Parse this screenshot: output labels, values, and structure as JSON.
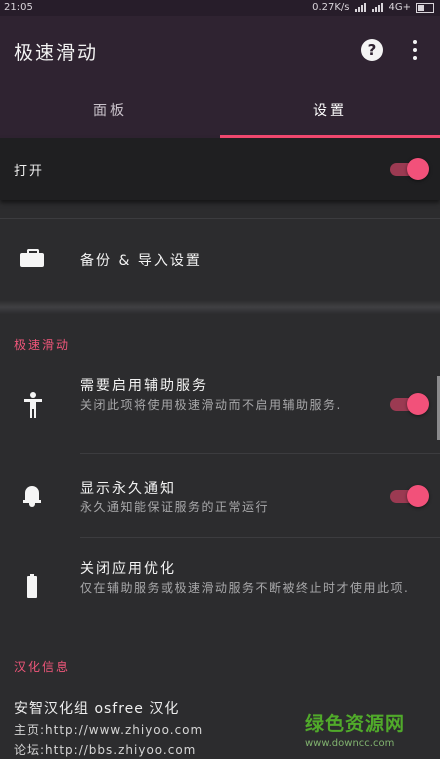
{
  "status_bar": {
    "time": "21:05",
    "speed": "0.27K/s",
    "network": "4G+"
  },
  "app_bar": {
    "title": "极速滑动",
    "help_icon": "help-circle-icon",
    "more_icon": "more-vert-icon"
  },
  "tabs": [
    {
      "label": "面板",
      "selected": false
    },
    {
      "label": "设置",
      "selected": true
    }
  ],
  "accent_color": "#f1486f",
  "master_switch": {
    "label": "打开",
    "on": true
  },
  "backup_row": {
    "icon": "briefcase-icon",
    "title": "备份 & 导入设置"
  },
  "sections": [
    {
      "header": "极速滑动",
      "items": [
        {
          "icon": "accessibility-icon",
          "title": "需要启用辅助服务",
          "subtitle": "关闭此项将使用极速滑动而不启用辅助服务.",
          "toggle": true
        },
        {
          "icon": "bell-icon",
          "title": "显示永久通知",
          "subtitle": "永久通知能保证服务的正常运行",
          "toggle": true
        },
        {
          "icon": "battery-icon",
          "title": "关闭应用优化",
          "subtitle": "仅在辅助服务或极速滑动服务不断被终止时才使用此项."
        }
      ]
    },
    {
      "header": "汉化信息",
      "credits": [
        "安智汉化组 osfree 汉化",
        "主页:http://www.zhiyoo.com",
        "论坛:http://bbs.zhiyoo.com"
      ]
    }
  ],
  "watermark": {
    "main": "绿色资源网",
    "url": "www.downcc.com"
  }
}
